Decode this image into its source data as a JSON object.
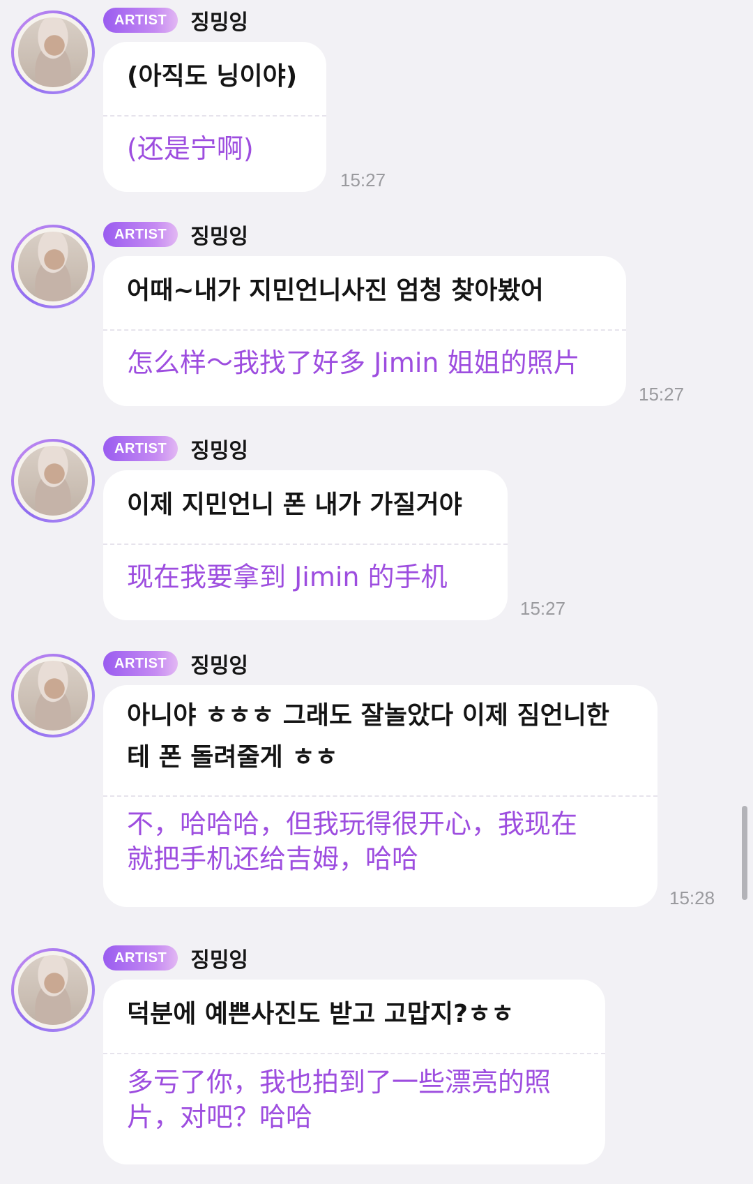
{
  "messages": [
    {
      "badge": "ARTIST",
      "sender": "징밍잉",
      "text": "(아직도 닝이야)",
      "translation": "(还是宁啊)",
      "time": "15:27"
    },
    {
      "badge": "ARTIST",
      "sender": "징밍잉",
      "text": "어때~내가 지민언니사진 엄청 찾아봤어",
      "translation": "怎么样～我找了好多 Jimin 姐姐的照片",
      "time": "15:27"
    },
    {
      "badge": "ARTIST",
      "sender": "징밍잉",
      "text": "이제 지민언니 폰 내가 가질거야",
      "translation": "现在我要拿到 Jimin 的手机",
      "time": "15:27"
    },
    {
      "badge": "ARTIST",
      "sender": "징밍잉",
      "text": "아니야 ㅎㅎㅎ 그래도 잘놀았다 이제 짐언니한\n테 폰 돌려줄게 ㅎㅎ",
      "translation": "不，哈哈哈，但我玩得很开心，我现在\n就把手机还给吉姆，哈哈",
      "time": "15:28"
    },
    {
      "badge": "ARTIST",
      "sender": "징밍잉",
      "text": "덕분에 예쁜사진도 받고 고맙지?ㅎㅎ",
      "translation": "多亏了你，我也拍到了一些漂亮的照\n片，对吧？哈哈",
      "time": ""
    }
  ]
}
